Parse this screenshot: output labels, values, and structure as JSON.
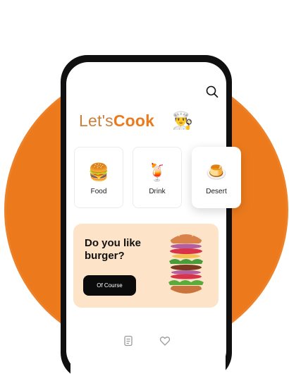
{
  "theme": {
    "accent": "#ec7a1c",
    "brand_light": "#c8803f",
    "promo_bg": "#fde3c8"
  },
  "header": {
    "brand_prefix": "Let's",
    "brand_suffix": "Cook",
    "chef_icon": "👨‍🍳",
    "search_icon": "search-icon"
  },
  "categories": [
    {
      "label": "Food",
      "emoji": "🍔"
    },
    {
      "label": "Drink",
      "emoji": "🍹"
    },
    {
      "label": "Desert",
      "emoji": "🍮"
    }
  ],
  "promo": {
    "title": "Do you like burger?",
    "button_label": "Of Course"
  },
  "bottom_nav": {
    "icons": [
      "home-icon",
      "list-icon",
      "heart-icon",
      "profile-icon"
    ]
  }
}
